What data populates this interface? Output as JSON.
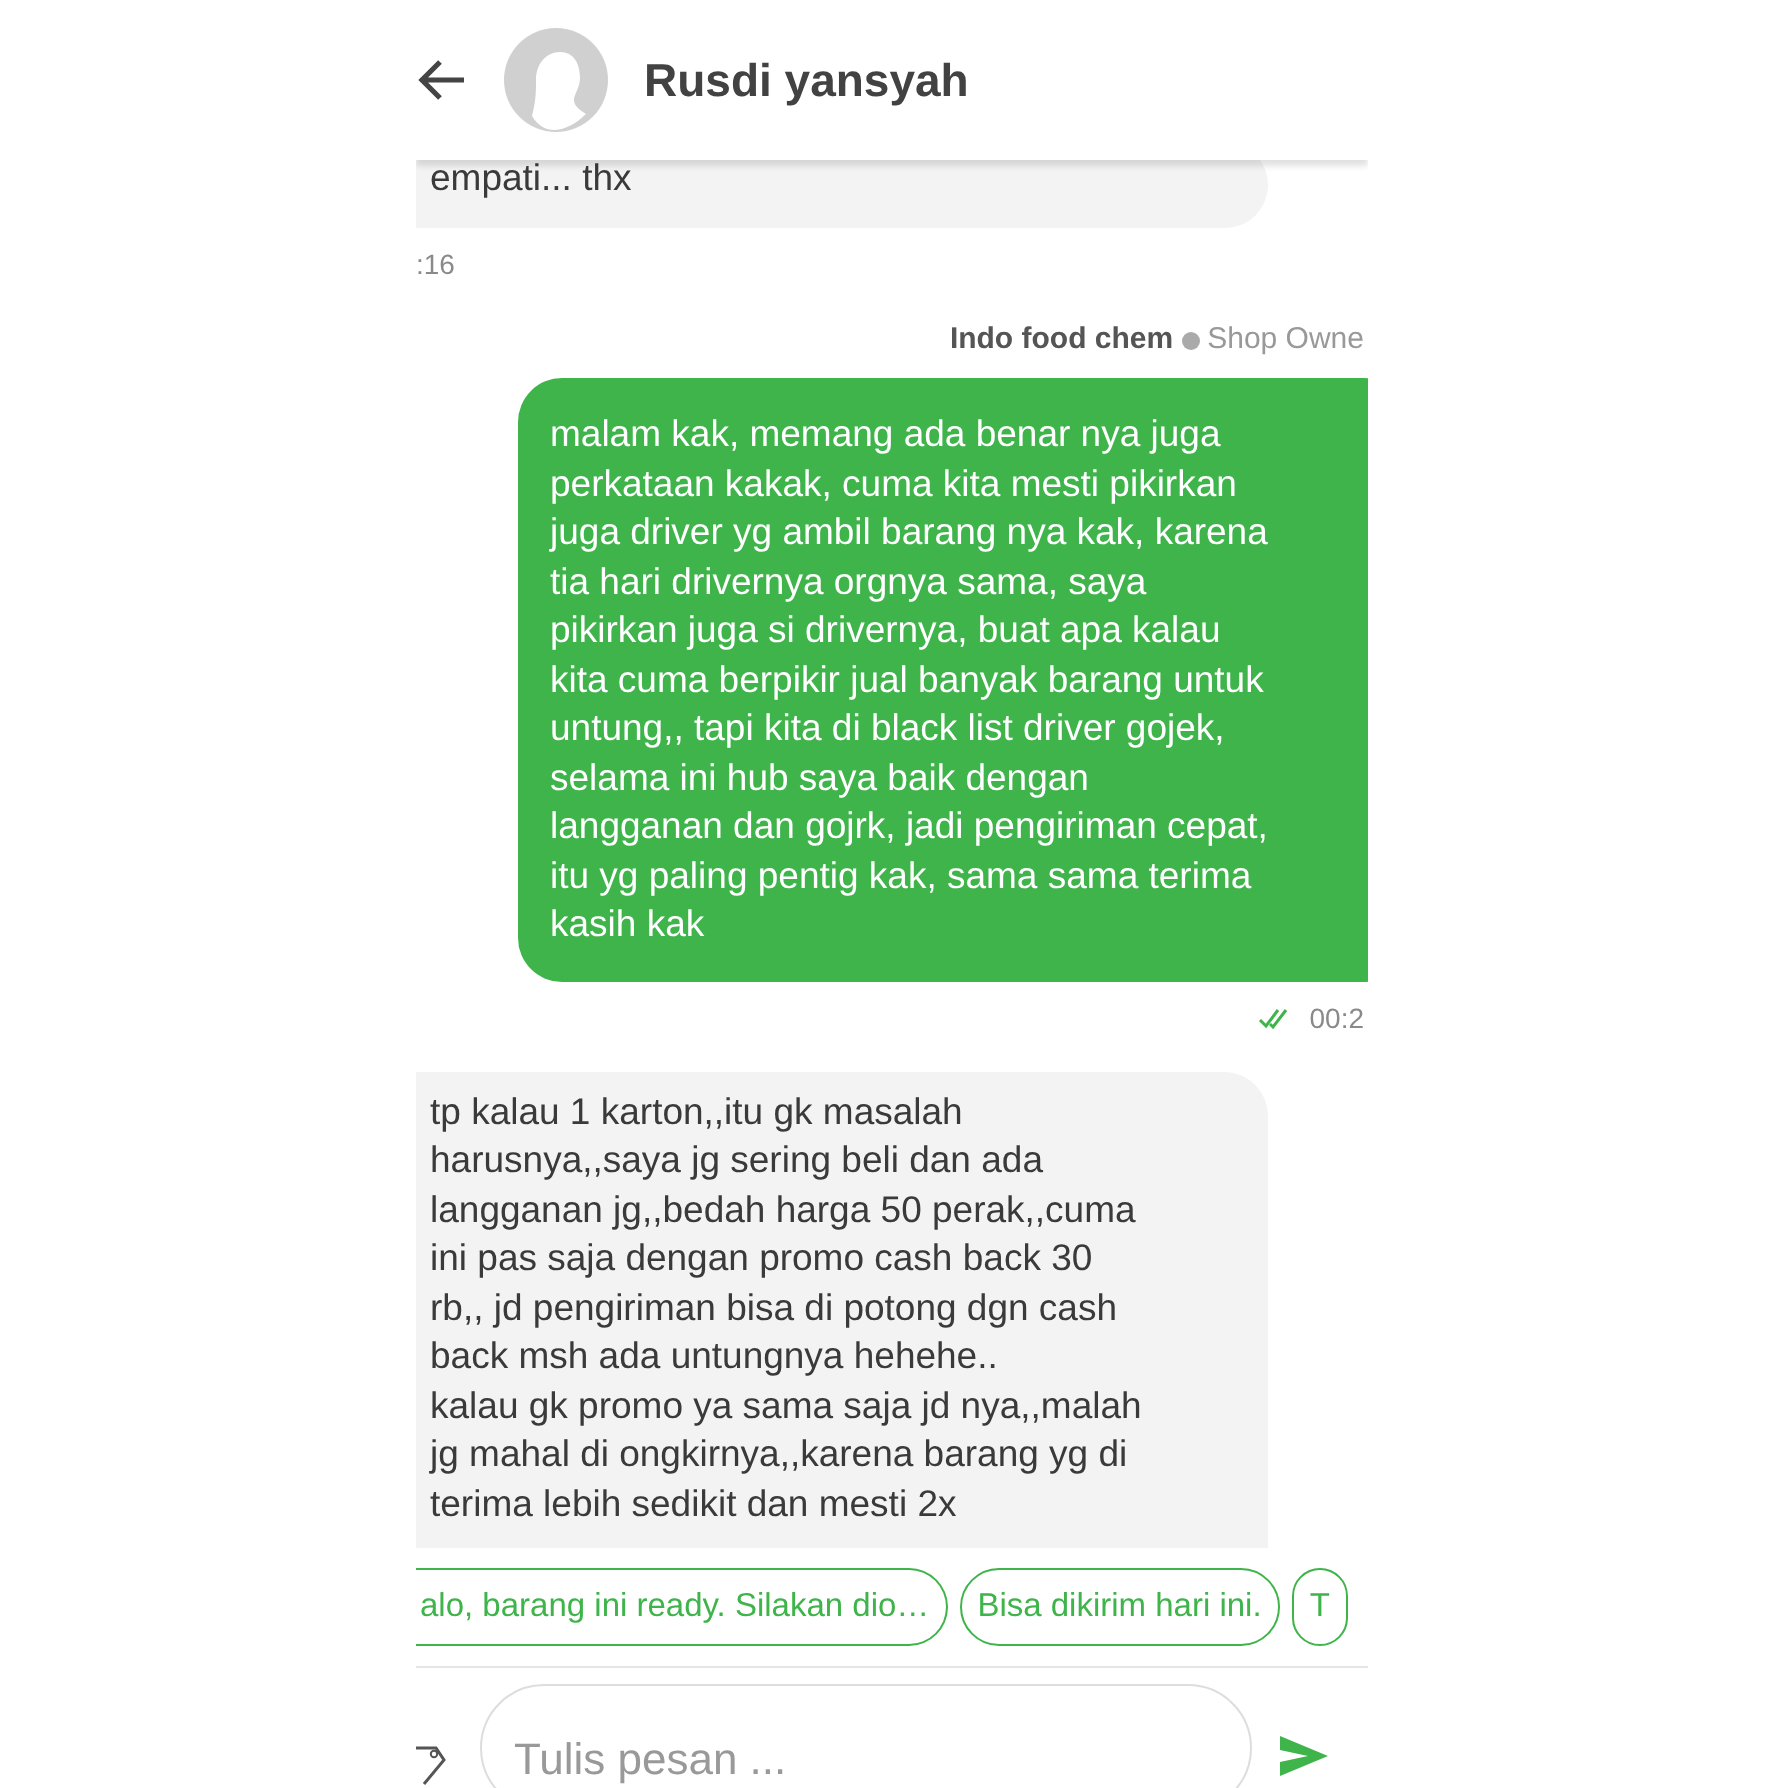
{
  "header": {
    "title": "Rusdi yansyah"
  },
  "messages": [
    {
      "kind": "received",
      "text": "empati... thx",
      "time": ":16"
    },
    {
      "kind": "sender_label",
      "name": "Indo food chem",
      "role": "Shop Owne"
    },
    {
      "kind": "sent",
      "text": "malam kak, memang ada benar nya juga\nperkataan kakak, cuma kita mesti pikirkan\njuga driver yg ambil barang nya kak, karena\ntia hari drivernya orgnya sama, saya\npikirkan juga si drivernya, buat apa kalau\nkita cuma berpikir jual banyak barang untuk\nuntung,, tapi kita di black list driver gojek,\nselama ini hub saya baik dengan\nlangganan dan gojrk, jadi pengiriman cepat,\nitu yg paling pentig kak, sama sama terima\nkasih kak",
      "time": "00:2",
      "read": true
    },
    {
      "kind": "received",
      "text": "tp kalau 1 karton,,itu gk masalah\nharusnya,,saya jg sering beli dan ada\nlangganan jg,,bedah harga 50 perak,,cuma\nini pas saja dengan promo cash back 30\nrb,, jd pengiriman bisa di potong dgn cash\nback msh ada untungnya hehehe..\nkalau gk promo ya sama saja jd nya,,malah\njg mahal di ongkirnya,,karena barang yg di\nterima lebih sedikit dan mesti 2x"
    }
  ],
  "quick_replies": [
    "alo, barang ini ready. Silakan dio…",
    "Bisa dikirim hari ini.",
    "T"
  ],
  "composer": {
    "placeholder": "Tulis pesan ..."
  }
}
